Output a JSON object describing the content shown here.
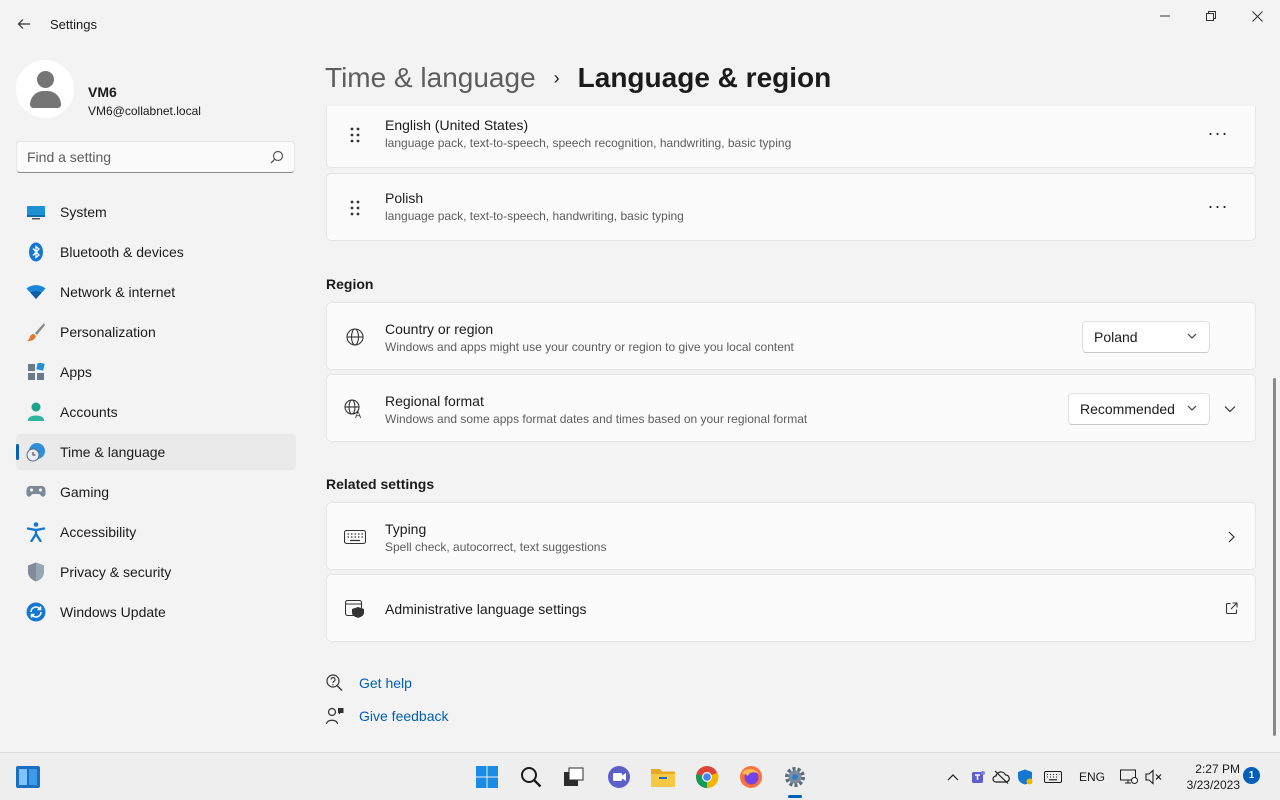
{
  "window": {
    "title": "Settings",
    "back_icon": "back-arrow-icon",
    "controls": [
      "minimize-icon",
      "restore-icon",
      "close-icon"
    ]
  },
  "profile": {
    "name": "VM6",
    "email": "VM6@collabnet.local"
  },
  "search": {
    "placeholder": "Find a setting"
  },
  "sidebar": {
    "items": [
      {
        "label": "System",
        "icon": "system-icon"
      },
      {
        "label": "Bluetooth & devices",
        "icon": "bluetooth-icon"
      },
      {
        "label": "Network & internet",
        "icon": "wifi-icon"
      },
      {
        "label": "Personalization",
        "icon": "brush-icon"
      },
      {
        "label": "Apps",
        "icon": "apps-icon"
      },
      {
        "label": "Accounts",
        "icon": "accounts-icon"
      },
      {
        "label": "Time & language",
        "icon": "time-language-icon",
        "selected": true
      },
      {
        "label": "Gaming",
        "icon": "gamepad-icon"
      },
      {
        "label": "Accessibility",
        "icon": "accessibility-icon"
      },
      {
        "label": "Privacy & security",
        "icon": "shield-icon"
      },
      {
        "label": "Windows Update",
        "icon": "update-icon"
      }
    ]
  },
  "breadcrumb": {
    "parent": "Time & language",
    "separator": "›",
    "current": "Language & region"
  },
  "languages": [
    {
      "name": "English (United States)",
      "features": "language pack, text-to-speech, speech recognition, handwriting, basic typing",
      "more": "···"
    },
    {
      "name": "Polish",
      "features": "language pack, text-to-speech, handwriting, basic typing",
      "more": "···"
    }
  ],
  "region": {
    "heading": "Region",
    "country": {
      "title": "Country or region",
      "desc": "Windows and apps might use your country or region to give you local content",
      "value": "Poland"
    },
    "format": {
      "title": "Regional format",
      "desc": "Windows and some apps format dates and times based on your regional format",
      "value": "Recommended"
    }
  },
  "related": {
    "heading": "Related settings",
    "typing": {
      "title": "Typing",
      "desc": "Spell check, autocorrect, text suggestions"
    },
    "admin": {
      "title": "Administrative language settings"
    }
  },
  "help": {
    "get_help": "Get help",
    "give_feedback": "Give feedback"
  },
  "taskbar": {
    "apps": [
      "start-icon",
      "search-icon",
      "task-view-icon",
      "teams-chat-icon",
      "file-explorer-icon",
      "chrome-icon",
      "firefox-icon",
      "settings-icon"
    ],
    "language": "ENG",
    "time": "2:27 PM",
    "date": "3/23/2023",
    "notifications": "1"
  },
  "colors": {
    "accent": "#005fb8",
    "window_bg": "#f3f3f3",
    "card_bg": "#fbfbfb"
  }
}
